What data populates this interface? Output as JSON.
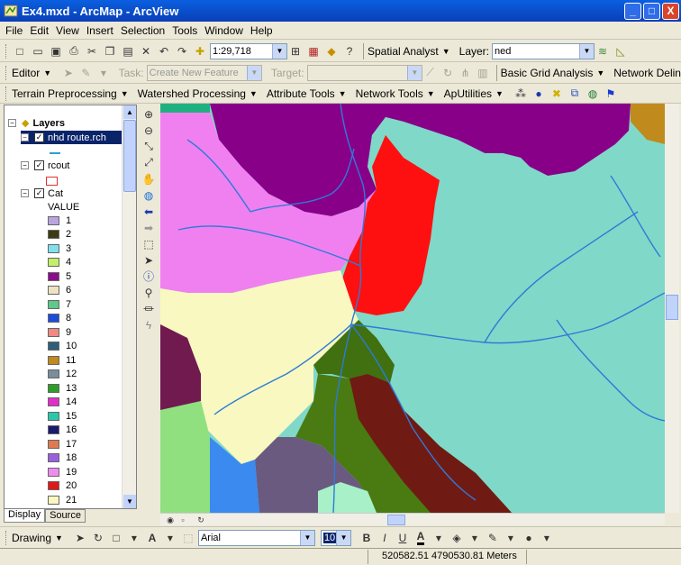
{
  "window": {
    "title": "Ex4.mxd - ArcMap - ArcView",
    "min": "_",
    "max": "□",
    "close": "X"
  },
  "menu": [
    "File",
    "Edit",
    "View",
    "Insert",
    "Selection",
    "Tools",
    "Window",
    "Help"
  ],
  "standard": {
    "scale": "1:29,718",
    "spatial_analyst": "Spatial Analyst",
    "layer_label": "Layer:",
    "layer_value": "ned"
  },
  "editor": {
    "editor_label": "Editor",
    "task_label": "Task:",
    "task_value": "Create New Feature",
    "target_label": "Target:",
    "basic_grid": "Basic Grid Analysis",
    "network_del": "Network Delin"
  },
  "arc_hydro": {
    "terrain": "Terrain Preprocessing",
    "watershed": "Watershed Processing",
    "attribute": "Attribute Tools",
    "network": "Network Tools",
    "aputilities": "ApUtilities"
  },
  "toc": {
    "root": "Layers",
    "layers": [
      {
        "name": "nhd route.rch"
      },
      {
        "name": "rcout"
      },
      {
        "name": "Cat",
        "field": "VALUE"
      }
    ],
    "classes": [
      {
        "label": "1",
        "color": "#B9A4E0"
      },
      {
        "label": "2",
        "color": "#3D3A14"
      },
      {
        "label": "3",
        "color": "#7FE0EE"
      },
      {
        "label": "4",
        "color": "#C3F06A"
      },
      {
        "label": "5",
        "color": "#8A0E8C"
      },
      {
        "label": "6",
        "color": "#EDE2C3"
      },
      {
        "label": "7",
        "color": "#5FC88A"
      },
      {
        "label": "8",
        "color": "#1E4CD8"
      },
      {
        "label": "9",
        "color": "#F08A82"
      },
      {
        "label": "10",
        "color": "#2E6078"
      },
      {
        "label": "11",
        "color": "#C08A1C"
      },
      {
        "label": "12",
        "color": "#7A8C9E"
      },
      {
        "label": "13",
        "color": "#2E9E2A"
      },
      {
        "label": "14",
        "color": "#E030C8"
      },
      {
        "label": "15",
        "color": "#2AC8A8"
      },
      {
        "label": "16",
        "color": "#1A1A6E"
      },
      {
        "label": "17",
        "color": "#E07A50"
      },
      {
        "label": "18",
        "color": "#9A60E0"
      },
      {
        "label": "19",
        "color": "#F08CF0"
      },
      {
        "label": "20",
        "color": "#E01818"
      },
      {
        "label": "21",
        "color": "#F8F8C0"
      }
    ],
    "tabs": [
      "Display",
      "Source"
    ]
  },
  "drawing": {
    "label": "Drawing",
    "font": "Arial",
    "size": "10"
  },
  "status": {
    "coords": "520582.51  4790530.81 Meters"
  },
  "colors": {
    "titlebar": "#0A4FD0",
    "map_teal": "#80D8C8",
    "map_red": "#FF1010",
    "map_purple": "#880088",
    "map_pink": "#F080F0",
    "map_yellow": "#F8F8C0",
    "map_olive": "#407010",
    "map_maroon": "#701A14",
    "map_blue": "#3A8AF0",
    "river": "#2E7AD8"
  }
}
